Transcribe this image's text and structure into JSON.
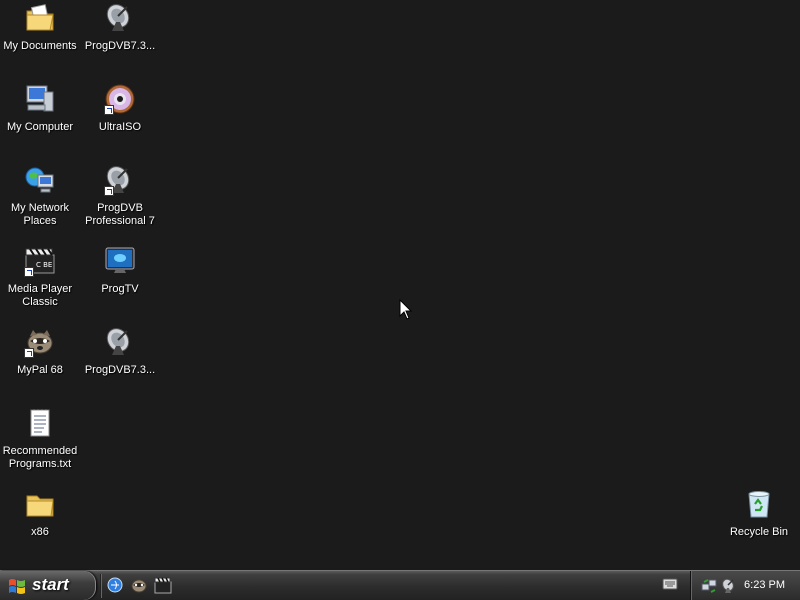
{
  "desktop": {
    "icons": [
      {
        "label": "My Documents",
        "icon": "my-documents-folder-icon"
      },
      {
        "label": "ProgDVB7.3...",
        "icon": "satellite-dish-icon"
      },
      {
        "label": "My Computer",
        "icon": "computer-icon"
      },
      {
        "label": "UltraISO",
        "icon": "disc-icon"
      },
      {
        "label": "My Network\nPlaces",
        "icon": "network-globe-icon"
      },
      {
        "label": "ProgDVB\nProfessional 7",
        "icon": "satellite-dish-icon"
      },
      {
        "label": "Media Player\nClassic",
        "icon": "clapperboard-icon"
      },
      {
        "label": "ProgTV",
        "icon": "monitor-icon"
      },
      {
        "label": "MyPal 68",
        "icon": "raccoon-icon"
      },
      {
        "label": "ProgDVB7.3...",
        "icon": "satellite-dish-icon"
      },
      {
        "label": "Recommended\nPrograms.txt",
        "icon": "text-file-icon"
      },
      {
        "label": "x86",
        "icon": "folder-icon"
      },
      {
        "label": "Recycle Bin",
        "icon": "recycle-bin-icon"
      }
    ]
  },
  "taskbar": {
    "start_label": "start",
    "quick_launch": [
      "browser-icon",
      "raccoon-icon",
      "clapperboard-icon"
    ],
    "clock": "6:23 PM"
  },
  "colors": {
    "desktop_bg": "#1b1b1b",
    "taskbar_bg": "#2c2c2c",
    "text": "#ffffff"
  }
}
